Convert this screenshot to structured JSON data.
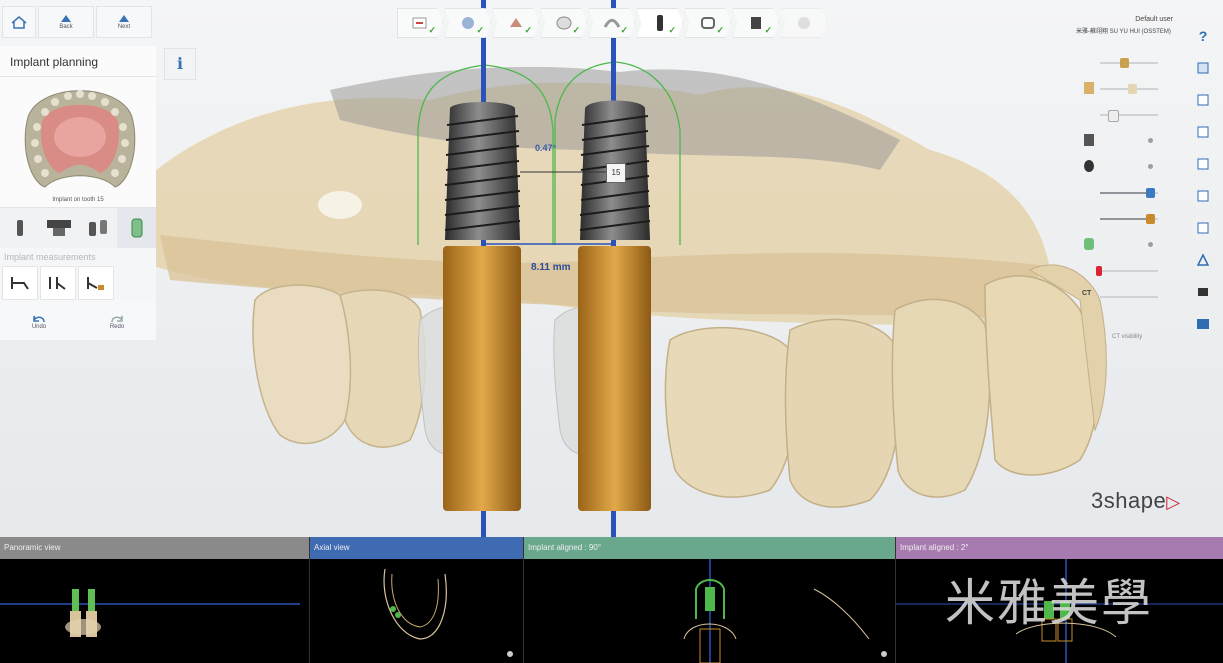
{
  "toolbar": {
    "home_icon": "home-icon",
    "back_label": "Back",
    "next_label": "Next"
  },
  "panel": {
    "title": "Implant planning",
    "info_label": "i",
    "thumbnail_caption": "Implant on tooth 15",
    "measurements_label": "Implant measurements",
    "undo_label": "Undo",
    "redo_label": "Redo"
  },
  "workflow_steps": [
    {
      "name": "scan-import",
      "done": true
    },
    {
      "name": "alignment",
      "done": true
    },
    {
      "name": "segmentation",
      "done": true
    },
    {
      "name": "crown-design",
      "done": true
    },
    {
      "name": "nerve-canal",
      "done": true
    },
    {
      "name": "implant-planning",
      "done": true,
      "current": true
    },
    {
      "name": "sleeve",
      "done": true
    },
    {
      "name": "guide-design",
      "done": true
    },
    {
      "name": "export",
      "done": false
    }
  ],
  "scene": {
    "angle_label": "0.47°",
    "distance_label": "8.11 mm",
    "tooth_number": "15"
  },
  "right_panel": {
    "user_title": "Default user",
    "user_name": "米雅-蘇翊翔 SU YU HUI (OSSTEM)",
    "ct_label": "CT",
    "ct_visibility_label": "CT visibility",
    "help_label": "?"
  },
  "views": {
    "panoramic_label": "Panoramic view",
    "axial_label": "Axial view",
    "aligned1_label": "Implant aligned : 90°",
    "aligned2_label": "Implant aligned : 2°"
  },
  "brand": {
    "name": "3shape"
  },
  "watermark": "米雅美學",
  "colors": {
    "implant_axis": "#2a52b8",
    "sleeve": "#c88a2c",
    "guide_outline": "#4fb84a",
    "axial_header": "#3f6bb3",
    "aligned1_header": "#6aa88e",
    "aligned2_header": "#a77bb0"
  }
}
